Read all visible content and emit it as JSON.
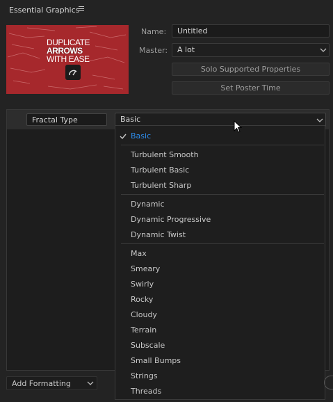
{
  "panel": {
    "title": "Essential Graphics",
    "menu_icon": "hamburger-icon"
  },
  "thumbnail": {
    "line1": "DUPLICATE",
    "line2": "ARROWS",
    "line3": "WITH EASE",
    "bg_color": "#a6282c"
  },
  "name": {
    "label": "Name:",
    "value": "Untitled"
  },
  "master": {
    "label": "Master:",
    "value": "A lot"
  },
  "buttons": {
    "solo": "Solo Supported Properties",
    "poster": "Set Poster Time"
  },
  "property": {
    "name": "Fractal Type",
    "value": "Basic"
  },
  "dropdown": {
    "selected": "Basic",
    "selected_color": "#2d8ceb",
    "groups": [
      [
        "Basic"
      ],
      [
        "Turbulent Smooth",
        "Turbulent Basic",
        "Turbulent Sharp"
      ],
      [
        "Dynamic",
        "Dynamic Progressive",
        "Dynamic Twist"
      ],
      [
        "Max",
        "Smeary",
        "Swirly",
        "Rocky",
        "Cloudy",
        "Terrain",
        "Subscale",
        "Small Bumps",
        "Strings",
        "Threads"
      ]
    ]
  },
  "footer": {
    "add_formatting": "Add Formatting"
  }
}
